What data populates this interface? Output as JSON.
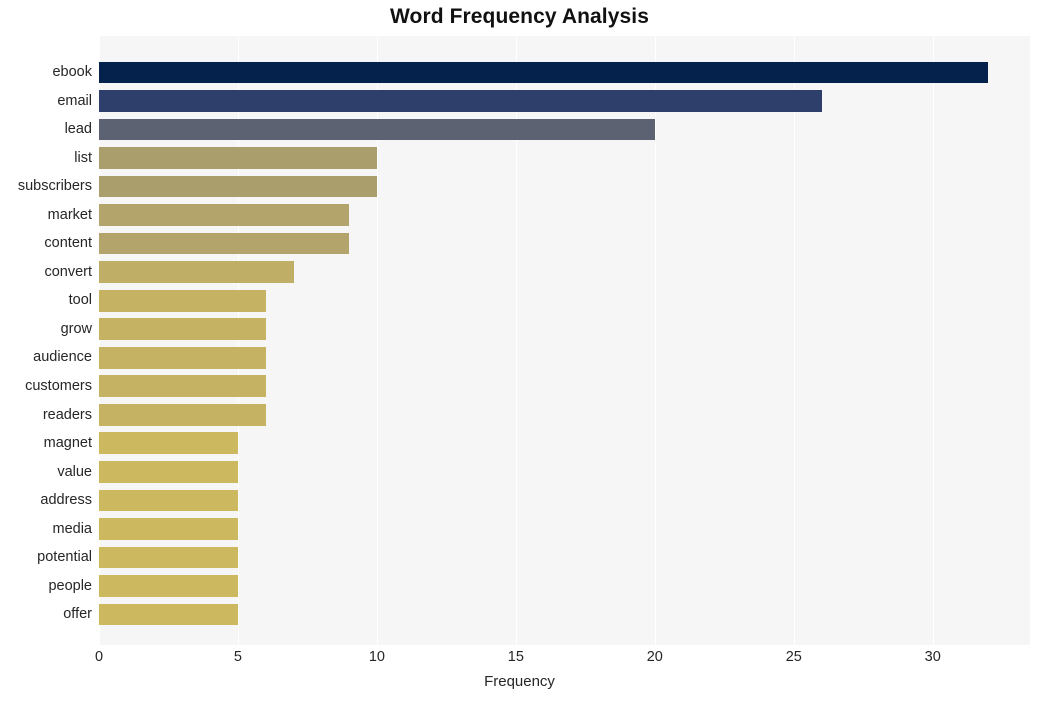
{
  "chart_data": {
    "type": "bar",
    "orientation": "horizontal",
    "title": "Word Frequency Analysis",
    "xlabel": "Frequency",
    "ylabel": "",
    "xlim": [
      0,
      33.5
    ],
    "xticks": [
      0,
      5,
      10,
      15,
      20,
      25,
      30
    ],
    "xtick_labels": [
      "0",
      "5",
      "10",
      "15",
      "20",
      "25",
      "30"
    ],
    "grid": "vertical-only",
    "legend": "none",
    "categories": [
      "ebook",
      "email",
      "lead",
      "list",
      "subscribers",
      "market",
      "content",
      "convert",
      "tool",
      "grow",
      "audience",
      "customers",
      "readers",
      "magnet",
      "value",
      "address",
      "media",
      "potential",
      "people",
      "offer"
    ],
    "values": [
      32,
      26,
      20,
      10,
      10,
      9,
      9,
      7,
      6,
      6,
      6,
      6,
      6,
      5,
      5,
      5,
      5,
      5,
      5,
      5
    ],
    "bar_colors": [
      "#04224c",
      "#2e3f6b",
      "#5d6272",
      "#aa9e6d",
      "#aa9e6d",
      "#b2a46b",
      "#b2a46b",
      "#bfae66",
      "#c5b263",
      "#c5b263",
      "#c5b263",
      "#c5b263",
      "#c5b263",
      "#ccb85f",
      "#ccb85f",
      "#ccb85f",
      "#ccb85f",
      "#ccb85f",
      "#ccb85f",
      "#ccb85f"
    ],
    "plot_background": "#f6f6f7",
    "grid_color": "#ffffff",
    "text_color": "#262626",
    "title_color": "#111111"
  }
}
